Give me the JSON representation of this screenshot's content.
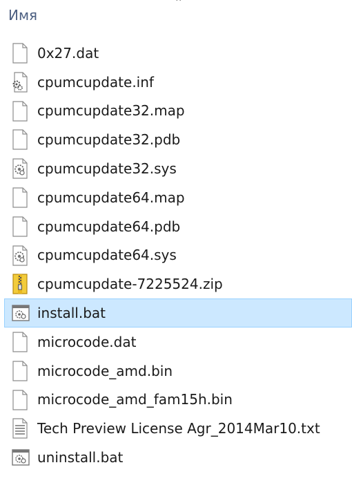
{
  "header": {
    "column_name": "Имя"
  },
  "files": [
    {
      "name": "0x27.dat",
      "icon": "blank-file-icon"
    },
    {
      "name": "cpumcupdate.inf",
      "icon": "settings-file-icon"
    },
    {
      "name": "cpumcupdate32.map",
      "icon": "blank-file-icon"
    },
    {
      "name": "cpumcupdate32.pdb",
      "icon": "blank-file-icon"
    },
    {
      "name": "cpumcupdate32.sys",
      "icon": "system-file-icon"
    },
    {
      "name": "cpumcupdate64.map",
      "icon": "blank-file-icon"
    },
    {
      "name": "cpumcupdate64.pdb",
      "icon": "blank-file-icon"
    },
    {
      "name": "cpumcupdate64.sys",
      "icon": "system-file-icon"
    },
    {
      "name": "cpumcupdate-7225524.zip",
      "icon": "zip-file-icon"
    },
    {
      "name": "install.bat",
      "icon": "batch-file-icon",
      "selected": true
    },
    {
      "name": "microcode.dat",
      "icon": "blank-file-icon"
    },
    {
      "name": "microcode_amd.bin",
      "icon": "blank-file-icon"
    },
    {
      "name": "microcode_amd_fam15h.bin",
      "icon": "blank-file-icon"
    },
    {
      "name": "Tech Preview License Agr_2014Mar10.txt",
      "icon": "text-file-icon"
    },
    {
      "name": "uninstall.bat",
      "icon": "batch-file-icon"
    }
  ],
  "colors": {
    "selection_bg": "#cce8ff",
    "selection_border": "#99d1ff",
    "header_text": "#4d6082"
  }
}
